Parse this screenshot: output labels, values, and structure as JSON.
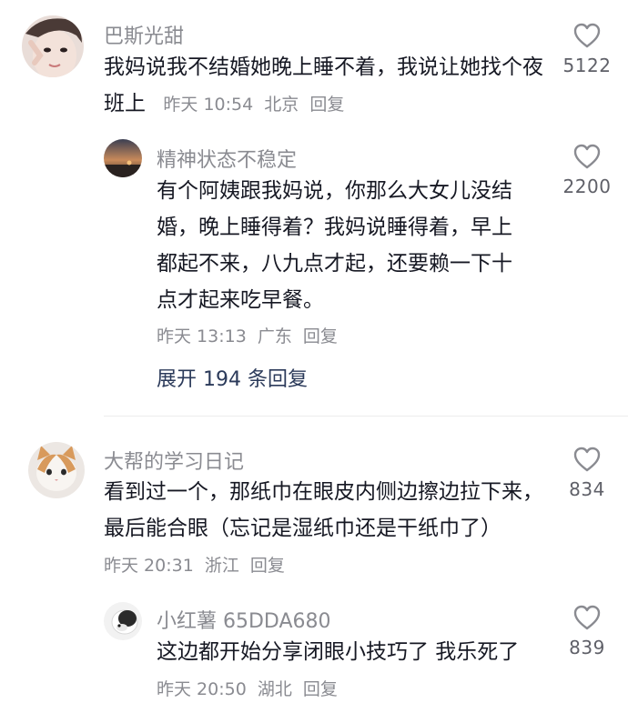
{
  "comments": [
    {
      "username": "巴斯光甜",
      "text": "我妈说我不结婚她晚上睡不着，我说让她找个夜班上",
      "time": "昨天 10:54",
      "location": "北京",
      "reply_label": "回复",
      "likes": "5122",
      "avatar_icon": "person-avatar"
    },
    {
      "username": "精神状态不稳定",
      "text": "有个阿姨跟我妈说，你那么大女儿没结婚，晚上睡得着？我妈说睡得着，早上都起不来，八九点才起，还要赖一下十点才起来吃早餐。",
      "time": "昨天 13:13",
      "location": "广东",
      "reply_label": "回复",
      "likes": "2200",
      "avatar_icon": "sunset-avatar",
      "expand_label": "展开 194 条回复"
    },
    {
      "username": "大帮的学习日记",
      "text": "看到过一个，那纸巾在眼皮内侧边擦边拉下来，最后能合眼（忘记是湿纸巾还是干纸巾了）",
      "time": "昨天 20:31",
      "location": "浙江",
      "reply_label": "回复",
      "likes": "834",
      "avatar_icon": "cat-avatar"
    },
    {
      "username": "小红薯 65DDA680",
      "text": "这边都开始分享闭眼小技巧了 我乐死了",
      "time": "昨天 20:50",
      "location": "湖北",
      "reply_label": "回复",
      "likes": "839",
      "avatar_icon": "dog-avatar"
    }
  ],
  "colors": {
    "text": "#161823",
    "secondary": "#8a8b91",
    "expand": "#2b3a5a",
    "like_icon": "#8a8b91"
  },
  "icons": {
    "like": "heart-outline-icon"
  }
}
